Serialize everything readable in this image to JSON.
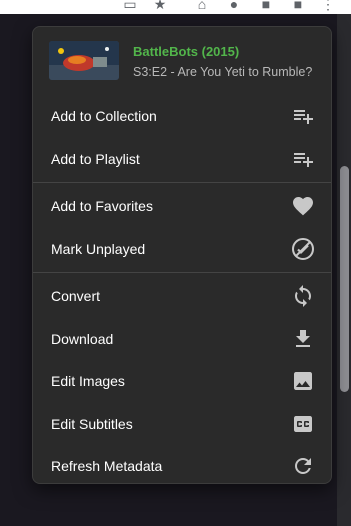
{
  "header": {
    "title": "BattleBots (2015)",
    "subtitle": "S3:E2 - Are You Yeti to Rumble?"
  },
  "menu": {
    "groups": [
      [
        {
          "label": "Add to Collection",
          "icon": "playlist-add-icon"
        },
        {
          "label": "Add to Playlist",
          "icon": "playlist-add-icon"
        }
      ],
      [
        {
          "label": "Add to Favorites",
          "icon": "heart-icon"
        },
        {
          "label": "Mark Unplayed",
          "icon": "check-circle-icon"
        }
      ],
      [
        {
          "label": "Convert",
          "icon": "sync-icon"
        },
        {
          "label": "Download",
          "icon": "download-icon"
        },
        {
          "label": "Edit Images",
          "icon": "image-icon"
        },
        {
          "label": "Edit Subtitles",
          "icon": "closed-caption-icon"
        },
        {
          "label": "Refresh Metadata",
          "icon": "refresh-icon"
        }
      ]
    ]
  },
  "colors": {
    "accent_green": "#52b54b",
    "menu_bg": "#2a2a2a",
    "page_bg": "#1a1820"
  }
}
